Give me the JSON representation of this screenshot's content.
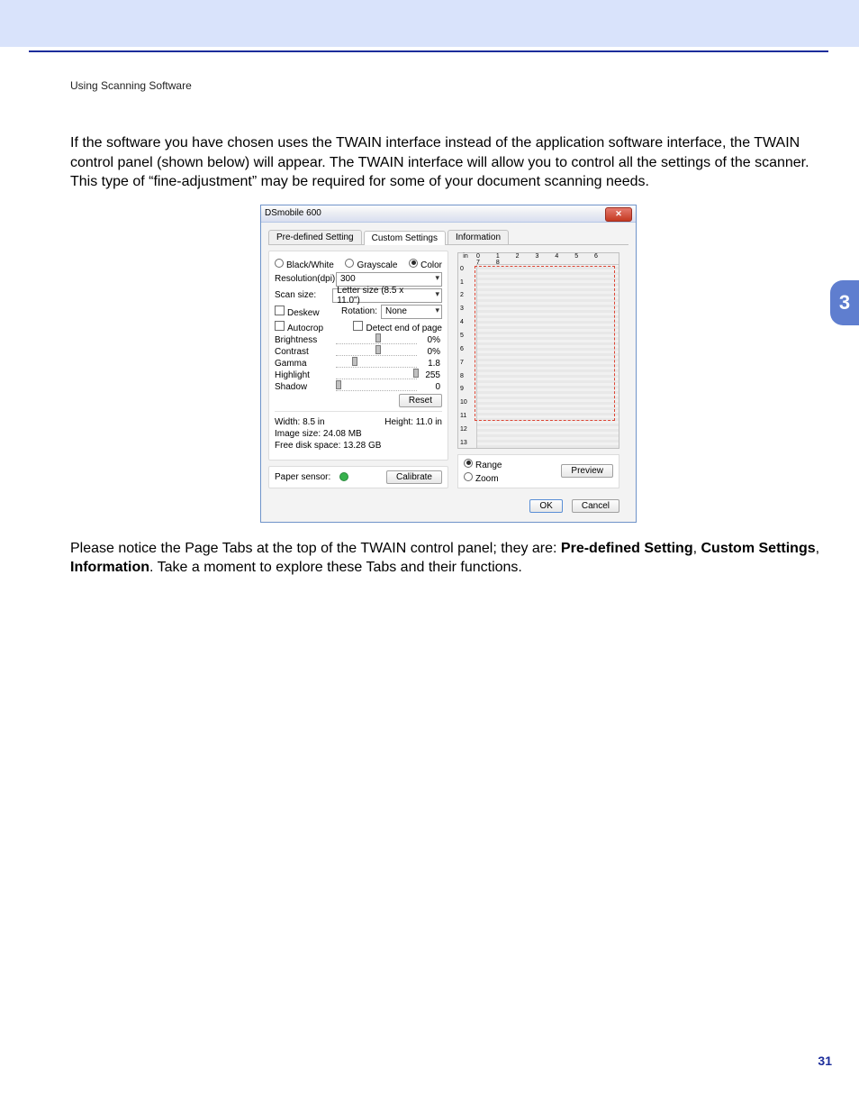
{
  "doc": {
    "section_heading": "Using Scanning Software",
    "para1": "If the software you have chosen uses the TWAIN interface instead of the application software interface, the TWAIN control panel (shown below) will appear. The TWAIN interface will allow you to control all the settings of the scanner. This type of “fine-adjustment” may be required for some of your document scanning needs.",
    "para2_pre": "Please notice the Page Tabs at the top of the TWAIN control panel; they are: ",
    "tab_a": "Pre-defined Setting",
    "comma1": ", ",
    "tab_b": "Custom Settings",
    "comma2": ", ",
    "tab_c": "Information",
    "para2_post": ". Take a moment to explore these Tabs and their functions.",
    "side_tab": "3",
    "page_number": "31"
  },
  "dlg": {
    "title": "DSmobile 600",
    "close_glyph": "✕",
    "tabs": {
      "predef": "Pre-defined Setting",
      "custom": "Custom Settings",
      "info": "Information"
    },
    "mode": {
      "bw": "Black/White",
      "gray": "Grayscale",
      "color": "Color"
    },
    "labels": {
      "resolution": "Resolution(dpi):",
      "scan_size": "Scan size:",
      "deskew": "Deskew",
      "rotation": "Rotation:",
      "autocrop": "Autocrop",
      "detect_eop": "Detect end of page",
      "brightness": "Brightness",
      "contrast": "Contrast",
      "gamma": "Gamma",
      "highlight": "Highlight",
      "shadow": "Shadow",
      "width": "Width: 8.5 in",
      "height": "Height: 11.0 in",
      "image_size": "Image size: 24.08 MB",
      "free_disk": "Free disk space: 13.28 GB",
      "paper_sensor": "Paper sensor:",
      "range": "Range",
      "zoom": "Zoom",
      "in": "in"
    },
    "values": {
      "resolution": "300",
      "scan_size": "Letter size (8.5 x 11.0\")",
      "rotation": "None",
      "brightness": "0%",
      "contrast": "0%",
      "gamma": "1.8",
      "highlight": "255",
      "shadow": "0"
    },
    "buttons": {
      "reset": "Reset",
      "calibrate": "Calibrate",
      "preview": "Preview",
      "ok": "OK",
      "cancel": "Cancel"
    },
    "ruler_top": "0 1 2 3 4 5 6 7 8",
    "ruler_left": [
      "0",
      "1",
      "2",
      "3",
      "4",
      "5",
      "6",
      "7",
      "8",
      "9",
      "10",
      "11",
      "12",
      "13"
    ]
  }
}
